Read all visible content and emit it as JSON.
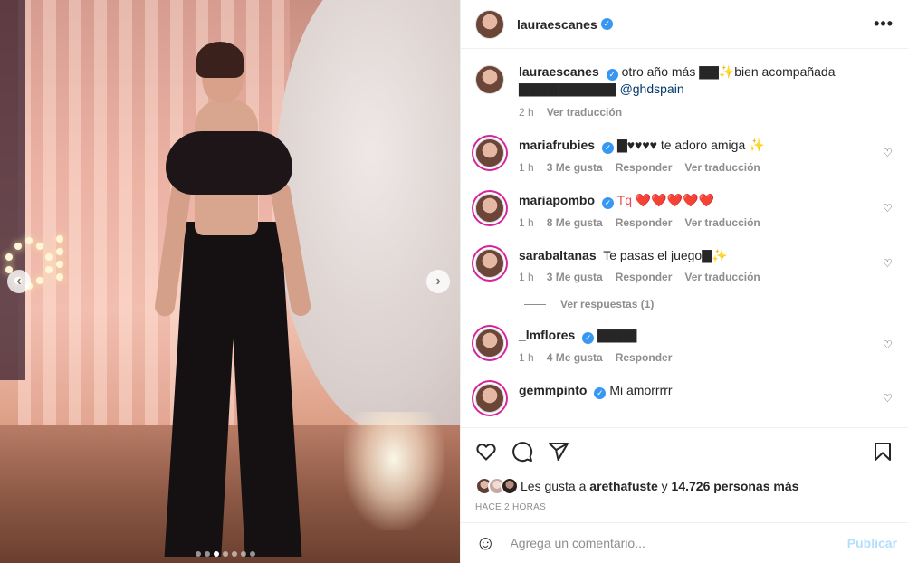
{
  "post": {
    "author": "lauraescanes",
    "author_verified": true,
    "caption_text": "otro año más ▇▇✨bien acompañada ▇▇▇▇▇▇▇▇▇▇",
    "caption_mention": "@ghdspain",
    "caption_time": "2 h",
    "caption_translate": "Ver traducción",
    "more_icon": "more-horizontal-icon",
    "carousel": {
      "total_slides": 7,
      "active_slide": 3
    }
  },
  "comments": [
    {
      "username": "mariafrubies",
      "verified": true,
      "text": "▇♥♥♥♥ te adoro amiga ✨",
      "time": "1 h",
      "likes": "3 Me gusta",
      "reply": "Responder",
      "translate": "Ver traducción"
    },
    {
      "username": "mariapombo",
      "verified": true,
      "text": "Tq ❤️❤️❤️❤️❤️",
      "time": "1 h",
      "likes": "8 Me gusta",
      "reply": "Responder",
      "translate": "Ver traducción"
    },
    {
      "username": "sarabaltanas",
      "verified": false,
      "text": "Te pasas el juego▇✨",
      "time": "1 h",
      "likes": "3 Me gusta",
      "reply": "Responder",
      "translate": "Ver traducción",
      "view_replies": "Ver respuestas (1)"
    },
    {
      "username": "_lmflores",
      "verified": true,
      "text": "▇▇▇▇",
      "time": "1 h",
      "likes": "4 Me gusta",
      "reply": "Responder"
    },
    {
      "username": "gemmpinto",
      "verified": true,
      "text": "Mi amorrrrr"
    }
  ],
  "actions": {
    "likes_prefix": "Les gusta a",
    "likes_user": "arethafuste",
    "likes_middle": "y",
    "likes_count": "14.726 personas más",
    "timestamp": "HACE 2 HORAS"
  },
  "composer": {
    "placeholder": "Agrega un comentario...",
    "publish": "Publicar"
  },
  "colors": {
    "verified": "#3897f0",
    "link": "#00376b",
    "muted": "#8e8e8e",
    "publish_disabled": "#b2dffc"
  }
}
